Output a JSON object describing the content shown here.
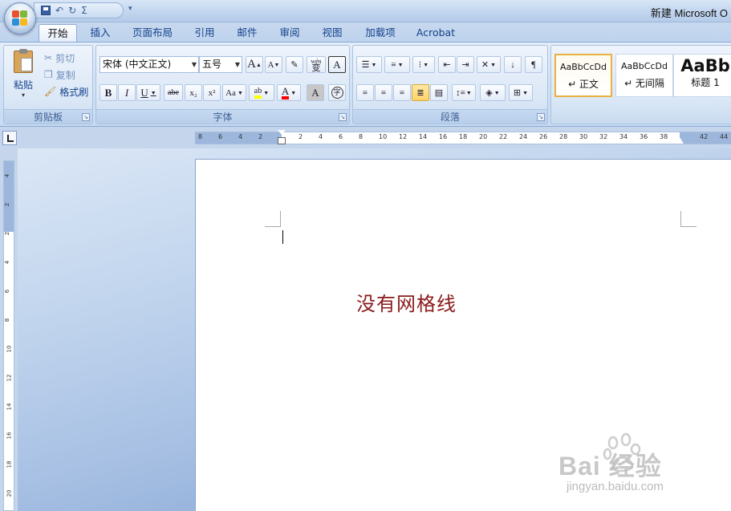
{
  "window": {
    "title": "新建 Microsoft O"
  },
  "qat": {
    "undo_glyph": "↶",
    "redo_glyph": "↻",
    "sigma_glyph": "Σ",
    "more_glyph": "▾"
  },
  "tabs": [
    {
      "label": "开始",
      "active": true
    },
    {
      "label": "插入"
    },
    {
      "label": "页面布局"
    },
    {
      "label": "引用"
    },
    {
      "label": "邮件"
    },
    {
      "label": "审阅"
    },
    {
      "label": "视图"
    },
    {
      "label": "加载项"
    },
    {
      "label": "Acrobat"
    }
  ],
  "clipboard": {
    "label": "剪贴板",
    "paste": "粘贴",
    "cut": "剪切",
    "copy": "复制",
    "format_painter": "格式刷"
  },
  "font": {
    "label": "字体",
    "font_name": "宋体 (中文正文)",
    "font_size": "五号",
    "bold": "B",
    "italic": "I",
    "underline": "U",
    "strike": "abe",
    "subscript": "x₂",
    "superscript": "x²",
    "change_case": "Aa",
    "grow": "A",
    "shrink": "A",
    "wen": "wén",
    "bian": "变",
    "border_char": "A",
    "shade_char": "A",
    "enclose": "字"
  },
  "paragraph": {
    "label": "段落"
  },
  "styles": [
    {
      "sample": "AaBbCcDd",
      "name": "↵ 正文",
      "selected": true
    },
    {
      "sample": "AaBbCcDd",
      "name": "↵ 无间隔"
    },
    {
      "sample": "AaBb",
      "name": "标题 1"
    }
  ],
  "ruler": {
    "ticks": [
      "8",
      "6",
      "4",
      "2",
      "2",
      "4",
      "6",
      "8",
      "10",
      "12",
      "14",
      "16",
      "18",
      "20",
      "22",
      "24",
      "26",
      "28",
      "30",
      "32",
      "34",
      "36",
      "38",
      "42",
      "44"
    ],
    "vticks": [
      "4",
      "2",
      "2",
      "4",
      "6",
      "8",
      "10",
      "12",
      "14",
      "16",
      "18",
      "20"
    ]
  },
  "document": {
    "text": "没有网格线"
  },
  "watermark": {
    "brand": "Bai  经验",
    "url": "jingyan.baidu.com"
  },
  "colors": {
    "text_red": "#8b1a1a",
    "highlight": "#ffff00",
    "font_color": "#ff0000"
  }
}
